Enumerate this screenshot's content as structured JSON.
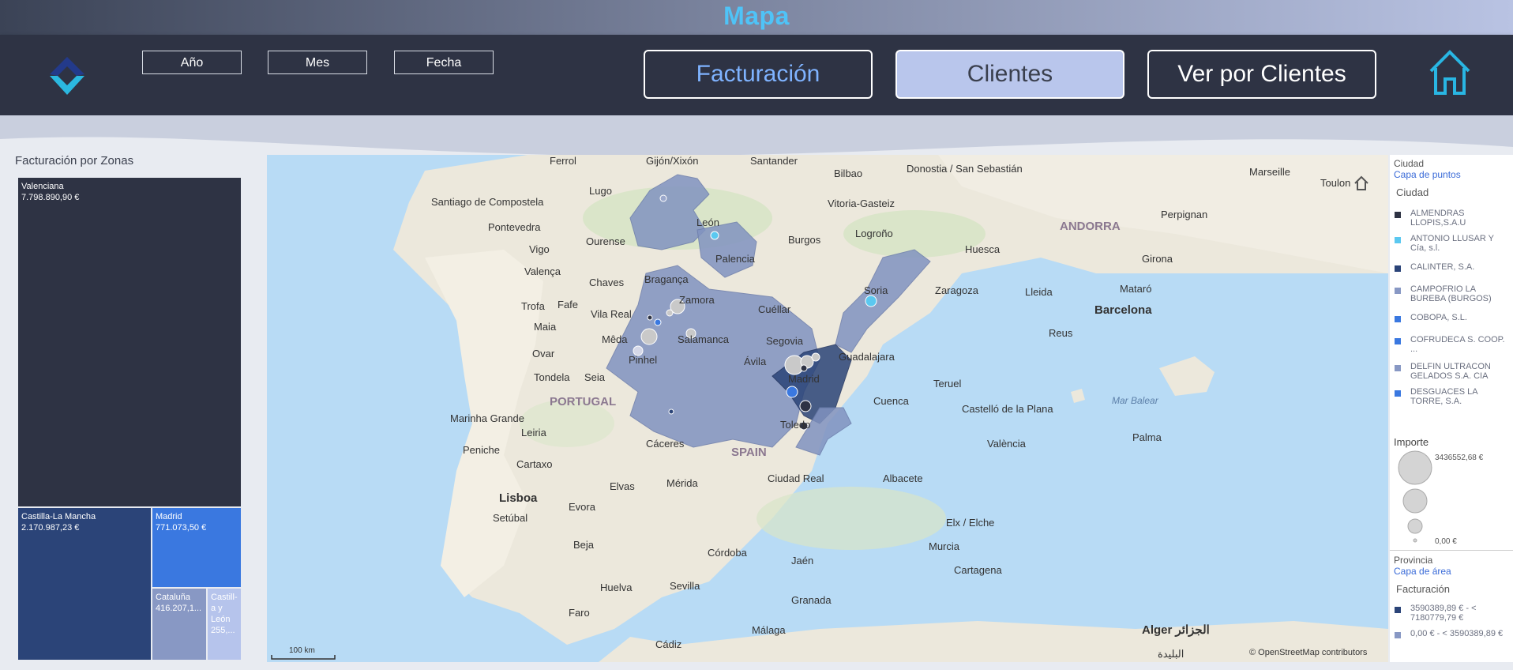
{
  "header": {
    "title": "Mapa",
    "filters": [
      "Año",
      "Mes",
      "Fecha"
    ],
    "nav": [
      {
        "label": "Facturación",
        "active": false
      },
      {
        "label": "Clientes",
        "active": true
      },
      {
        "label": "Ver por Clientes",
        "active": false
      }
    ]
  },
  "treemap": {
    "title": "Facturación por Zonas",
    "tiles": [
      {
        "name": "Valenciana",
        "value": "7.798.890,90 €",
        "color": "#2e3344"
      },
      {
        "name": "Castilla-La Mancha",
        "value": "2.170.987,23 €",
        "color": "#2b4478"
      },
      {
        "name": "Madrid",
        "value": "771.073,50 €",
        "color": "#3a78e0"
      },
      {
        "name": "Cataluña",
        "value": "416.207,1...",
        "color": "#8898c4"
      },
      {
        "name": "Castill-a y León",
        "value": "255,...",
        "color": "#b6c4ec"
      }
    ]
  },
  "map": {
    "labels": {
      "ferrol": "Ferrol",
      "gijon": "Gijón/Xixón",
      "santander": "Santander",
      "bilbao": "Bilbao",
      "donostia": "Donostia / San Sebastián",
      "marseille": "Marseille",
      "toulon": "Toulon",
      "santiago": "Santiago de Compostela",
      "lugo": "Lugo",
      "vitoria": "Vitoria-Gasteiz",
      "pontevedra": "Pontevedra",
      "ourense": "Ourense",
      "leon": "León",
      "burgos": "Burgos",
      "logrono": "Logroño",
      "andorra": "ANDORRA",
      "perpignan": "Perpignan",
      "vigo": "Vigo",
      "huesca": "Huesca",
      "valenca": "Valença",
      "palencia": "Palencia",
      "girona": "Girona",
      "chaves": "Chaves",
      "braganca": "Bragança",
      "soria": "Soria",
      "zaragoza": "Zaragoza",
      "lleida": "Lleida",
      "mataro": "Mataró",
      "zamora": "Zamora",
      "trofa": "Trofa",
      "fafe": "Fafe",
      "vilareal": "Vila Real",
      "cuellar": "Cuéllar",
      "barcelona": "Barcelona",
      "reus": "Reus",
      "maia": "Maia",
      "meda": "Mêda",
      "salamanca": "Salamanca",
      "segovia": "Segovia",
      "guadalajara": "Guadalajara",
      "ovar": "Ovar",
      "pinhel": "Pinhel",
      "avila": "Ávila",
      "madrid": "Madrid",
      "tondela": "Tondela",
      "seia": "Seia",
      "teruel": "Teruel",
      "portugal": "PORTUGAL",
      "cuenca": "Cuenca",
      "marbalear": "Mar Balear",
      "castellon": "Castelló de la Plana",
      "marinha": "Marinha Grande",
      "leiria": "Leiria",
      "toledo": "Toledo",
      "valencia": "València",
      "caceres": "Cáceres",
      "spain": "SPAIN",
      "palma": "Palma",
      "peniche": "Peniche",
      "cartaxo": "Cartaxo",
      "ciudadreal": "Ciudad Real",
      "albacete": "Albacete",
      "elvas": "Elvas",
      "merida": "Mérida",
      "lisboa": "Lisboa",
      "evora": "Evora",
      "setubal": "Setúbal",
      "elche": "Elx / Elche",
      "beja": "Beja",
      "murcia": "Murcia",
      "cordoba": "Córdoba",
      "jaen": "Jaén",
      "cartagena": "Cartagena",
      "huelva": "Huelva",
      "sevilla": "Sevilla",
      "granada": "Granada",
      "faro": "Faro",
      "malaga": "Málaga",
      "cadiz": "Cádiz",
      "alger": "Alger الجزائر",
      "blida": "البليدة",
      "scale": "100 km",
      "attribution": "© OpenStreetMap contributors"
    }
  },
  "legend": {
    "group1_title": "Ciudad",
    "group1_sub": "Capa de puntos",
    "group1_heading": "Ciudad",
    "items": [
      {
        "label": "ALMENDRAS LLOPIS,S.A.U",
        "color": "#2e3344"
      },
      {
        "label": "ANTONIO LLUSAR Y Cía, s.l.",
        "color": "#5bc8f0"
      },
      {
        "label": "CALINTER, S.A.",
        "color": "#2b4478"
      },
      {
        "label": "CAMPOFRIO LA BUREBA (BURGOS)",
        "color": "#8898c4"
      },
      {
        "label": "COBOPA, S.L.",
        "color": "#3a78e0"
      },
      {
        "label": "COFRUDECA S. COOP. ...",
        "color": "#3a78e0"
      },
      {
        "label": "DELFIN ULTRACON GELADOS S.A. CIA",
        "color": "#8898c4"
      },
      {
        "label": "DESGUACES LA TORRE, S.A.",
        "color": "#3a78e0"
      }
    ],
    "size_title": "Importe",
    "size_max": "3436552,68 €",
    "size_min": "0,00 €",
    "group2_title": "Provincia",
    "group2_sub": "Capa de área",
    "group2_heading": "Facturación",
    "ranges": [
      {
        "label": "3590389,89 € - < 7180779,79 €",
        "color": "#2b4478"
      },
      {
        "label": "0,00 € - < 3590389,89 €",
        "color": "#8898c4"
      }
    ]
  },
  "colors": {
    "accent": "#4fc3f7",
    "header_bg": "#2e3344",
    "nav_active_bg": "#b9c6ec"
  }
}
